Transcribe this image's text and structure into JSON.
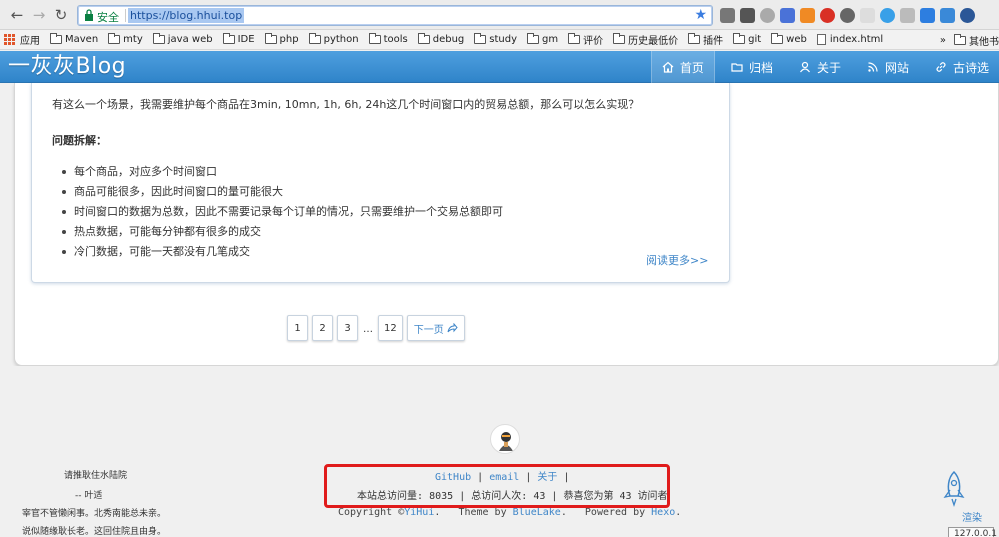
{
  "browser": {
    "security_label": "安全",
    "url": "https://blog.hhui.top",
    "bookmarks": [
      {
        "label": "应用",
        "kind": "apps"
      },
      {
        "label": "Maven",
        "kind": "folder"
      },
      {
        "label": "mty",
        "kind": "folder"
      },
      {
        "label": "java web",
        "kind": "folder"
      },
      {
        "label": "IDE",
        "kind": "folder"
      },
      {
        "label": "php",
        "kind": "folder"
      },
      {
        "label": "python",
        "kind": "folder"
      },
      {
        "label": "tools",
        "kind": "folder"
      },
      {
        "label": "debug",
        "kind": "folder"
      },
      {
        "label": "study",
        "kind": "folder"
      },
      {
        "label": "gm",
        "kind": "folder"
      },
      {
        "label": "评价",
        "kind": "folder"
      },
      {
        "label": "历史最低价",
        "kind": "folder"
      },
      {
        "label": "插件",
        "kind": "folder"
      },
      {
        "label": "git",
        "kind": "folder"
      },
      {
        "label": "web",
        "kind": "folder"
      },
      {
        "label": "index.html",
        "kind": "page"
      }
    ],
    "bookmarks_overflow": "»",
    "other_bookmarks": "其他书"
  },
  "site": {
    "logo": "一灰灰Blog",
    "nav": [
      {
        "label": "首页",
        "icon": "home-icon",
        "active": true
      },
      {
        "label": "归档",
        "icon": "folder-icon",
        "active": false
      },
      {
        "label": "关于",
        "icon": "user-icon",
        "active": false
      },
      {
        "label": "网站",
        "icon": "rss-icon",
        "active": false
      },
      {
        "label": "古诗选",
        "icon": "link-icon",
        "active": false
      }
    ]
  },
  "article": {
    "intro": "有这么一个场景，我需要维护每个商品在3min, 10mn, 1h, 6h, 24h这几个时间窗口内的贸易总额，那么可以怎么实现？",
    "sub_heading": "问题拆解：",
    "bullets": [
      "每个商品，对应多个时间窗口",
      "商品可能很多，因此时间窗口的量可能很大",
      "时间窗口的数据为总数，因此不需要记录每个订单的情况，只需要维护一个交易总额即可",
      "热点数据，可能每分钟都有很多的成交",
      "冷门数据，可能一天都没有几笔成交"
    ],
    "read_more": "阅读更多>>"
  },
  "pagination": {
    "pages": [
      "1",
      "2",
      "3"
    ],
    "ellipsis": "…",
    "last_page": "12",
    "next": "下一页"
  },
  "footer": {
    "left_lines": [
      "请推耿住水陆院",
      "--  叶适",
      "宰官不管懒闲事。北秀南能总未亲。",
      "说似随缘耿长老。这回住院且由身。"
    ],
    "links": [
      "GitHub",
      "email",
      "关于"
    ],
    "link_sep": "|",
    "stats": {
      "pv_label": "本站总访问量:",
      "pv": "8035",
      "uv_label": "总访问人次:",
      "uv": "43",
      "congrats_label": "恭喜您为第",
      "visitor_no": "43",
      "visitor_suffix": "访问者"
    },
    "copyright": {
      "prefix": "Copyright ©",
      "author": "YiHui",
      "theme_label": "Theme by",
      "theme": "BlueLake",
      "powered_label": "Powered by",
      "powered": "Hexo"
    },
    "render_label": "渲染",
    "ip_badge": "127.0.0.1"
  },
  "colors": {
    "header_blue": "#3a8fd4",
    "link_blue": "#3f86c8",
    "highlight_red": "#e01b1b"
  }
}
